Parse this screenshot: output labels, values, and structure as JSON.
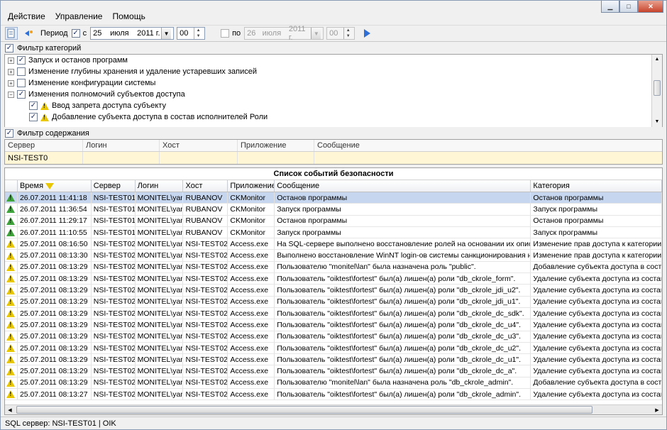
{
  "menu": [
    "Действие",
    "Управление",
    "Помощь"
  ],
  "toolbar": {
    "period_label": "Период",
    "from_label": "с",
    "from_day": "25",
    "from_month": "июля",
    "from_year": "2011 г.",
    "from_hour": "00",
    "to_label": "по",
    "to_day": "26",
    "to_month": "июля",
    "to_year": "2011 г.",
    "to_hour": "00"
  },
  "category_filter": {
    "label": "Фильтр категорий",
    "items": [
      {
        "label": "Запуск и останов программ",
        "checked": true,
        "expander": "+",
        "level": 0
      },
      {
        "label": "Изменение глубины хранения и удаление устаревших записей",
        "checked": false,
        "expander": "+",
        "level": 0
      },
      {
        "label": "Изменение конфигурации системы",
        "checked": false,
        "expander": "+",
        "level": 0
      },
      {
        "label": "Изменения полномочий субъектов доступа",
        "checked": true,
        "expander": "−",
        "level": 0
      },
      {
        "label": "Ввод запрета доступа субъекту",
        "checked": true,
        "expander": "",
        "level": 1
      },
      {
        "label": "Добавление субъекта доступа в состав исполнителей Роли",
        "checked": true,
        "expander": "",
        "level": 1
      }
    ]
  },
  "content_filter": {
    "label": "Фильтр содержания",
    "columns": [
      "Сервер",
      "Логин",
      "Хост",
      "Приложение",
      "Сообщение"
    ],
    "values": [
      "NSI-TEST0",
      "",
      "",
      "",
      ""
    ]
  },
  "events": {
    "title": "Список событий безопасности",
    "columns": [
      "Время",
      "Сервер",
      "Логин",
      "Хост",
      "Приложение",
      "Сообщение",
      "Категория"
    ],
    "rows": [
      {
        "icon": "green",
        "cells": [
          "26.07.2011 11:41:18",
          "NSI-TEST01",
          "MONITEL\\yan",
          "RUBANOV",
          "CKMonitor",
          "Останов программы",
          "Останов программы"
        ]
      },
      {
        "icon": "green",
        "cells": [
          "26.07.2011 11:36:54",
          "NSI-TEST01",
          "MONITEL\\yan",
          "RUBANOV",
          "CKMonitor",
          "Запуск программы",
          "Запуск программы"
        ]
      },
      {
        "icon": "green",
        "cells": [
          "26.07.2011 11:29:17",
          "NSI-TEST01",
          "MONITEL\\yan",
          "RUBANOV",
          "CKMonitor",
          "Останов программы",
          "Останов программы"
        ]
      },
      {
        "icon": "green",
        "cells": [
          "26.07.2011 11:10:55",
          "NSI-TEST01",
          "MONITEL\\yan",
          "RUBANOV",
          "CKMonitor",
          "Запуск программы",
          "Запуск программы"
        ]
      },
      {
        "icon": "yellow",
        "cells": [
          "25.07.2011 08:16:50",
          "NSI-TEST02",
          "MONITEL\\yan",
          "NSI-TEST02",
          "Access.exe",
          "На SQL-сервере выполнено восстановление ролей на основании их описания",
          "Изменение прав доступа к категории з"
        ]
      },
      {
        "icon": "yellow",
        "cells": [
          "25.07.2011 08:13:30",
          "NSI-TEST02",
          "MONITEL\\yan",
          "NSI-TEST02",
          "Access.exe",
          "Выполнено восстановление WinNT login-ов системы санкционирования на SQL",
          "Изменение прав доступа к категории з"
        ]
      },
      {
        "icon": "yellow",
        "cells": [
          "25.07.2011 08:13:29",
          "NSI-TEST02",
          "MONITEL\\yan",
          "NSI-TEST02",
          "Access.exe",
          "Пользователю \"monitel\\lan\" была назначена роль \"public\".",
          "Добавление субъекта доступа в состав"
        ]
      },
      {
        "icon": "yellow",
        "cells": [
          "25.07.2011 08:13:29",
          "NSI-TEST02",
          "MONITEL\\yan",
          "NSI-TEST02",
          "Access.exe",
          "Пользователь \"oiktest\\fortest\" был(а) лишен(а) роли \"db_ckrole_form\".",
          "Удаление субъекта доступа из состава"
        ]
      },
      {
        "icon": "yellow",
        "cells": [
          "25.07.2011 08:13:29",
          "NSI-TEST02",
          "MONITEL\\yan",
          "NSI-TEST02",
          "Access.exe",
          "Пользователь \"oiktest\\fortest\" был(а) лишен(а) роли \"db_ckrole_jdi_u2\".",
          "Удаление субъекта доступа из состава"
        ]
      },
      {
        "icon": "yellow",
        "cells": [
          "25.07.2011 08:13:29",
          "NSI-TEST02",
          "MONITEL\\yan",
          "NSI-TEST02",
          "Access.exe",
          "Пользователь \"oiktest\\fortest\" был(а) лишен(а) роли \"db_ckrole_jdi_u1\".",
          "Удаление субъекта доступа из состава"
        ]
      },
      {
        "icon": "yellow",
        "cells": [
          "25.07.2011 08:13:29",
          "NSI-TEST02",
          "MONITEL\\yan",
          "NSI-TEST02",
          "Access.exe",
          "Пользователь \"oiktest\\fortest\" был(а) лишен(а) роли \"db_ckrole_dc_sdk\".",
          "Удаление субъекта доступа из состава"
        ]
      },
      {
        "icon": "yellow",
        "cells": [
          "25.07.2011 08:13:29",
          "NSI-TEST02",
          "MONITEL\\yan",
          "NSI-TEST02",
          "Access.exe",
          "Пользователь \"oiktest\\fortest\" был(а) лишен(а) роли \"db_ckrole_dc_u4\".",
          "Удаление субъекта доступа из состава"
        ]
      },
      {
        "icon": "yellow",
        "cells": [
          "25.07.2011 08:13:29",
          "NSI-TEST02",
          "MONITEL\\yan",
          "NSI-TEST02",
          "Access.exe",
          "Пользователь \"oiktest\\fortest\" был(а) лишен(а) роли \"db_ckrole_dc_u3\".",
          "Удаление субъекта доступа из состава"
        ]
      },
      {
        "icon": "yellow",
        "cells": [
          "25.07.2011 08:13:29",
          "NSI-TEST02",
          "MONITEL\\yan",
          "NSI-TEST02",
          "Access.exe",
          "Пользователь \"oiktest\\fortest\" был(а) лишен(а) роли \"db_ckrole_dc_u2\".",
          "Удаление субъекта доступа из состава"
        ]
      },
      {
        "icon": "yellow",
        "cells": [
          "25.07.2011 08:13:29",
          "NSI-TEST02",
          "MONITEL\\yan",
          "NSI-TEST02",
          "Access.exe",
          "Пользователь \"oiktest\\fortest\" был(а) лишен(а) роли \"db_ckrole_dc_u1\".",
          "Удаление субъекта доступа из состава"
        ]
      },
      {
        "icon": "yellow",
        "cells": [
          "25.07.2011 08:13:29",
          "NSI-TEST02",
          "MONITEL\\yan",
          "NSI-TEST02",
          "Access.exe",
          "Пользователь \"oiktest\\fortest\" был(а) лишен(а) роли \"db_ckrole_dc_a\".",
          "Удаление субъекта доступа из состава"
        ]
      },
      {
        "icon": "yellow",
        "cells": [
          "25.07.2011 08:13:29",
          "NSI-TEST02",
          "MONITEL\\yan",
          "NSI-TEST02",
          "Access.exe",
          "Пользователю \"monitel\\lan\" была назначена роль \"db_ckrole_admin\".",
          "Добавление субъекта доступа в состав"
        ]
      },
      {
        "icon": "yellow",
        "cells": [
          "25.07.2011 08:13:27",
          "NSI-TEST02",
          "MONITEL\\yan",
          "NSI-TEST02",
          "Access.exe",
          "Пользователь \"oiktest\\fortest\" был(а) лишен(а) роли \"db_ckrole_admin\".",
          "Удаление субъекта доступа из состава"
        ]
      }
    ]
  },
  "status": "SQL сервер: NSI-TEST01 | OIK"
}
